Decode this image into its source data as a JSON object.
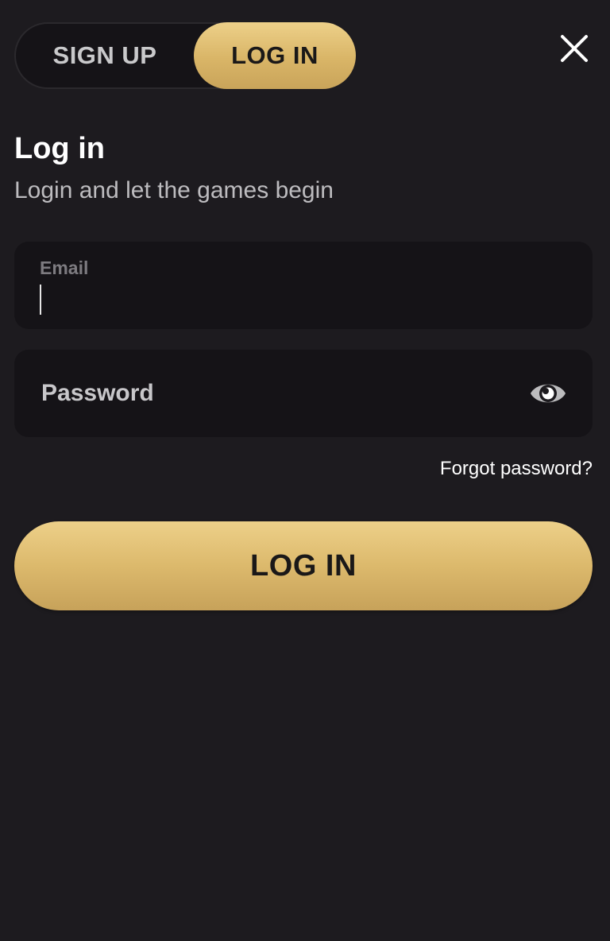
{
  "tabs": {
    "signup_label": "SIGN UP",
    "login_label": "LOG IN",
    "active": "login"
  },
  "header": {
    "close_icon": "close-icon"
  },
  "form": {
    "title": "Log in",
    "subtitle": "Login and let the games begin",
    "email": {
      "label": "Email",
      "value": ""
    },
    "password": {
      "placeholder": "Password",
      "value": "",
      "toggle_icon": "eye-icon"
    },
    "forgot_label": "Forgot password?",
    "submit_label": "LOG IN"
  },
  "colors": {
    "background": "#1d1b1f",
    "field_background": "#151317",
    "accent_gold": "#e2bf72",
    "text_muted": "#bdbcbf"
  }
}
